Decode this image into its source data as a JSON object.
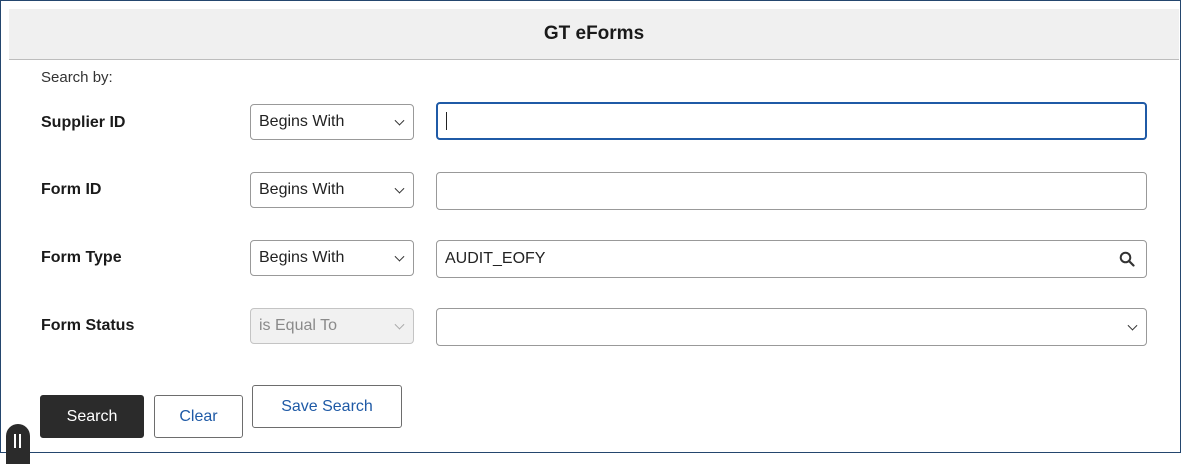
{
  "header": {
    "title": "GT eForms"
  },
  "search_by_label": "Search by:",
  "fields": [
    {
      "label": "Supplier ID",
      "operator": "Begins With",
      "value": "",
      "operator_disabled": false,
      "focused": true
    },
    {
      "label": "Form ID",
      "operator": "Begins With",
      "value": ""
    },
    {
      "label": "Form Type",
      "operator": "Begins With",
      "value": "AUDIT_EOFY",
      "has_lookup": true,
      "lookup_icon": "search-icon"
    },
    {
      "label": "Form Status",
      "operator": "is Equal To",
      "operator_disabled": true,
      "value": "",
      "value_is_dropdown": true
    }
  ],
  "buttons": {
    "search": "Search",
    "clear": "Clear",
    "save_search": "Save Search"
  },
  "colors": {
    "frame_border": "#24466e",
    "primary_button": "#2b2b2b",
    "link_blue": "#1f5aa6",
    "header_bg": "#f0f0f0"
  }
}
